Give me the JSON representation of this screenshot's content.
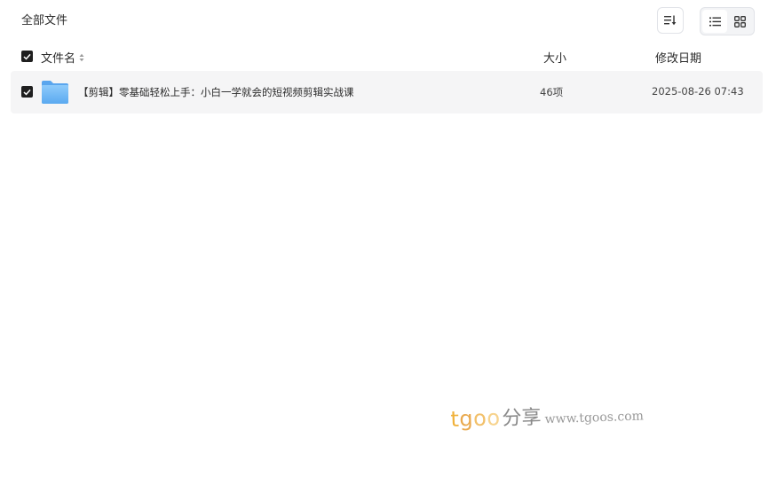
{
  "header": {
    "breadcrumb": "全部文件"
  },
  "toolbar": {
    "sort_icon": "sort-icon",
    "view_list_icon": "list-view-icon",
    "view_grid_icon": "grid-view-icon",
    "active_view": "list"
  },
  "table": {
    "columns": {
      "name": "文件名",
      "size": "大小",
      "date": "修改日期"
    },
    "rows": [
      {
        "icon": "folder-icon",
        "checked": true,
        "name": "【剪辑】零基础轻松上手：小白一学就会的短视频剪辑实战课",
        "size": "46项",
        "date": "2025-08-26 07:43"
      }
    ],
    "select_all_checked": true
  },
  "watermark": {
    "brand_t": "t",
    "brand_g": "g",
    "brand_o1": "o",
    "brand_o2": "o",
    "cn": "分享",
    "url": "www.tgoos.com"
  },
  "colors": {
    "checkbox": "#1f1f1f",
    "row_bg": "#f5f5f6",
    "folder": "#6fb6f5",
    "border": "#e1e3e8"
  }
}
